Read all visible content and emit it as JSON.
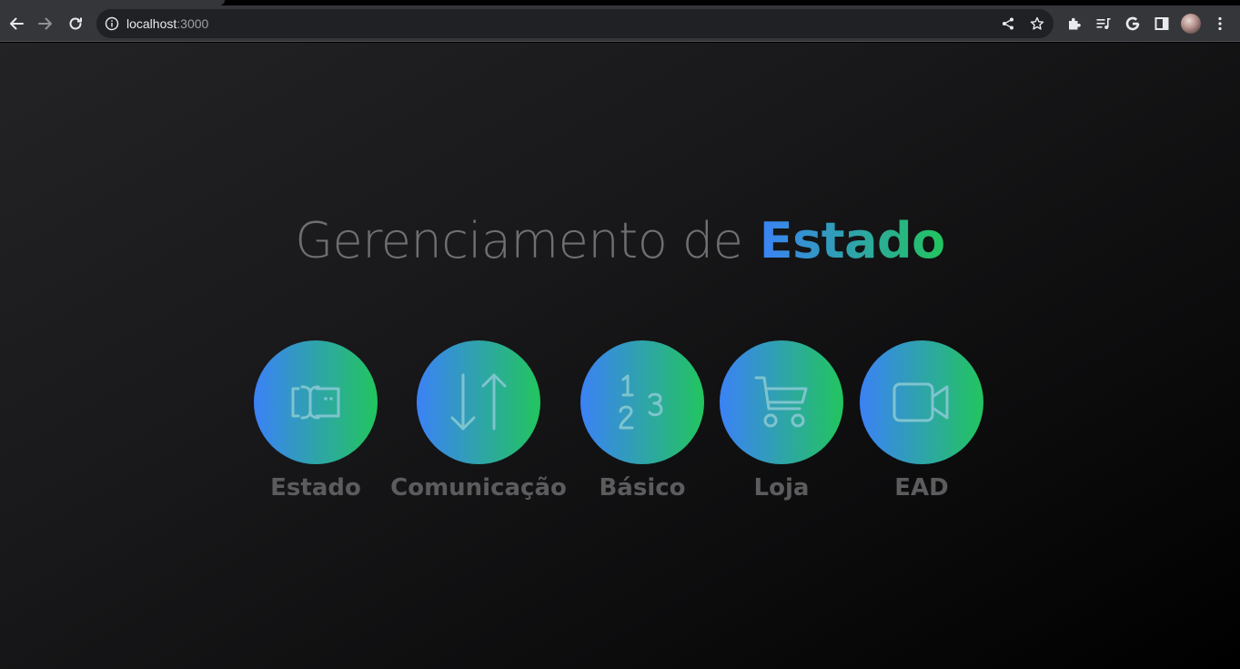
{
  "browser": {
    "url_host": "localhost",
    "url_port": ":3000"
  },
  "page": {
    "title_prefix": "Gerenciamento de",
    "title_highlight": "Estado",
    "gradient_start": "#3b82f6",
    "gradient_end": "#22c55e",
    "cards": [
      {
        "label": "Estado",
        "icon": "brackets-box-icon"
      },
      {
        "label": "Comunicação",
        "icon": "arrows-up-down-icon"
      },
      {
        "label": "Básico",
        "icon": "numbers-123-icon"
      },
      {
        "label": "Loja",
        "icon": "shopping-cart-icon"
      },
      {
        "label": "EAD",
        "icon": "video-camera-icon"
      }
    ]
  }
}
